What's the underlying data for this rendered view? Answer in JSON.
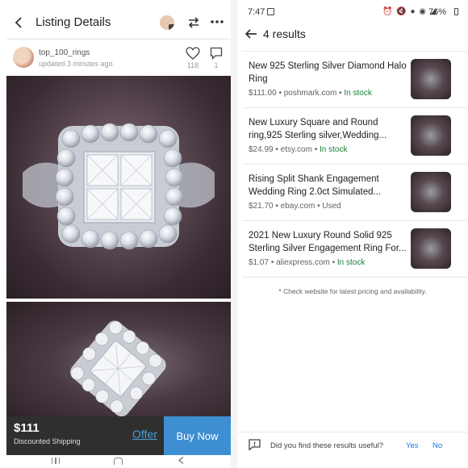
{
  "listing": {
    "header": {
      "title": "Listing Details",
      "icons": [
        "back-chevron-icon",
        "seller-avatar-icon",
        "swap-icon",
        "more-icon"
      ]
    },
    "seller": {
      "name": "top_100_rings",
      "updated": "updated 3 minutes ago",
      "likes": "118",
      "comments": "1"
    },
    "purchase": {
      "price": "$111",
      "shipping": "Discounted Shipping",
      "offer_label": "Offer",
      "buy_label": "Buy Now"
    },
    "colors": {
      "buy_button": "#3d8fd1",
      "bar": "#2f2f2f",
      "offer": "#4a9fd6"
    }
  },
  "search": {
    "status": {
      "time": "7:47",
      "battery": "76%"
    },
    "title": "4 results",
    "results": [
      {
        "title": "New 925 Sterling Silver Diamond Halo Ring",
        "price": "$111.00",
        "site": "poshmark.com",
        "availability": "In stock"
      },
      {
        "title": "New Luxury Square and Round ring,925 Sterling silver,Wedding...",
        "price": "$24.99",
        "site": "etsy.com",
        "availability": "In stock"
      },
      {
        "title": "Rising Split Shank Engagement Wedding Ring 2.0ct Simulated...",
        "price": "$21.70",
        "site": "ebay.com",
        "availability": "Used"
      },
      {
        "title": "2021 New Luxury Round Solid 925 Sterling Silver Engagement Ring For...",
        "price": "$1.07",
        "site": "aliexpress.com",
        "availability": "In stock"
      }
    ],
    "separator": "•",
    "disclaimer": "* Check website for latest pricing and availability.",
    "feedback": {
      "question": "Did you find these results useful?",
      "yes": "Yes",
      "no": "No"
    },
    "colors": {
      "in_stock": "#188038",
      "link": "#1a73e8"
    }
  }
}
